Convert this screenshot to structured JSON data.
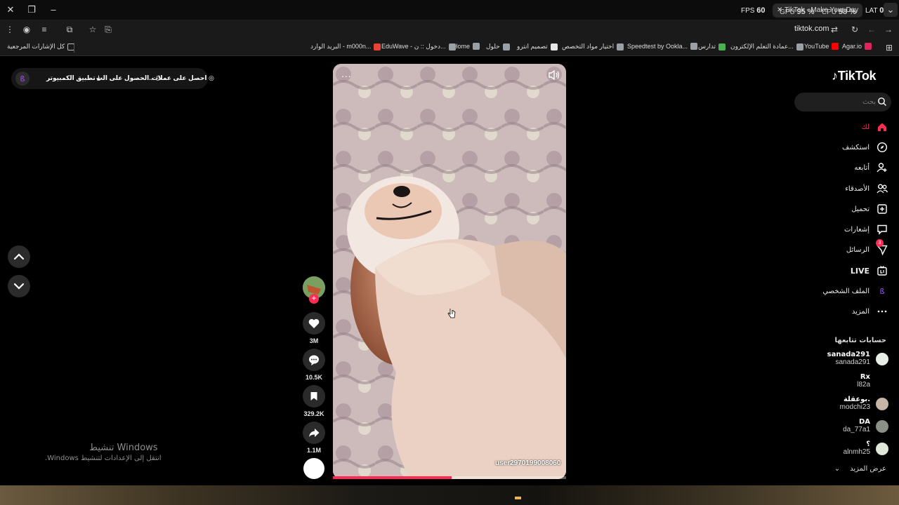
{
  "browser": {
    "tab_title": "TikTok - Make Your Day",
    "perf": {
      "fps_label": "FPS",
      "fps_value": "60",
      "gpu_label": "GPU",
      "gpu_value": "95 %",
      "cpu_label": "CPU",
      "cpu_value": "58 %",
      "lat_label": "LAT",
      "lat_value": "0 ms"
    },
    "url": "tiktok.com"
  },
  "bookmarks": [
    {
      "label": "Agar.io",
      "color": "#e0245e"
    },
    {
      "label": "YouTube",
      "color": "#ff0000"
    },
    {
      "label": "عمادة التعلم الإلكترون...",
      "color": "#9aa0a6"
    },
    {
      "label": "تدارس",
      "color": "#4caf50"
    },
    {
      "label": "Speedtest by Ookla...",
      "color": "#9aa0a6"
    },
    {
      "label": "اختيار مواد التخصص",
      "color": "#9aa0a6"
    },
    {
      "label": "تصميم انترو",
      "color": "#e6e6e6"
    },
    {
      "label": "حلول",
      "color": "#9aa0a6"
    },
    {
      "label": "Home",
      "color": "#9aa0a6"
    },
    {
      "label": "EduWave - دخول :: ن...",
      "color": "#9aa0a6"
    },
    {
      "label": "البريد الوارد - m000n...",
      "color": "#ea4335"
    }
  ],
  "all_bookmarks_label": "كل الإشارات المرجعية",
  "promo": {
    "coins": "احصل على عملات",
    "get_app": "الحصول على الت...",
    "desktop_app": "تطبيق الكمبيوتر"
  },
  "video": {
    "username": "user2970199008060",
    "progress": 0.51,
    "more_label": "..."
  },
  "actions": {
    "likes": "3M",
    "comments": "10.5K",
    "saves": "329.2K",
    "shares": "1.1M"
  },
  "sidebar": {
    "logo": "TikTok",
    "search_placeholder": "بحث",
    "nav": [
      {
        "label": "لك",
        "icon": "home-icon",
        "active": true
      },
      {
        "label": "استكشف",
        "icon": "compass-icon"
      },
      {
        "label": "أتابعه",
        "icon": "user-follow-icon"
      },
      {
        "label": "الأصدقاء",
        "icon": "friends-icon"
      },
      {
        "label": "تحميل",
        "icon": "upload-icon"
      },
      {
        "label": "إشعارات",
        "icon": "notifications-icon"
      },
      {
        "label": "الرسائل",
        "icon": "messages-icon",
        "badge": "3"
      },
      {
        "label": "LIVE",
        "icon": "live-icon"
      },
      {
        "label": "الملف الشخصي",
        "icon": "profile-icon"
      },
      {
        "label": "المزيد",
        "icon": "more-icon"
      }
    ],
    "following_title": "حسابات تتابعها",
    "accounts": [
      {
        "name": "sanada291",
        "handle": "sanada291",
        "avatar_color": "#e8efe6"
      },
      {
        "name": "Rx",
        "handle": "l82a",
        "avatar_color": ""
      },
      {
        "name": "بوعقلة.",
        "handle": "modchi23",
        "avatar_color": "#c7b6a6"
      },
      {
        "name": "DA",
        "handle": "da_77a1",
        "avatar_color": "#8b8f86"
      },
      {
        "name": "؟",
        "handle": "alnmh25",
        "avatar_color": "#dfe6da"
      }
    ],
    "see_more": "عرض المزيد"
  },
  "watermark": {
    "title": "تنشيط Windows",
    "subtitle": "انتقل إلى الإعدادات لتنشيط Windows."
  },
  "colors": {
    "accent": "#fe2c55",
    "background": "#000000"
  }
}
